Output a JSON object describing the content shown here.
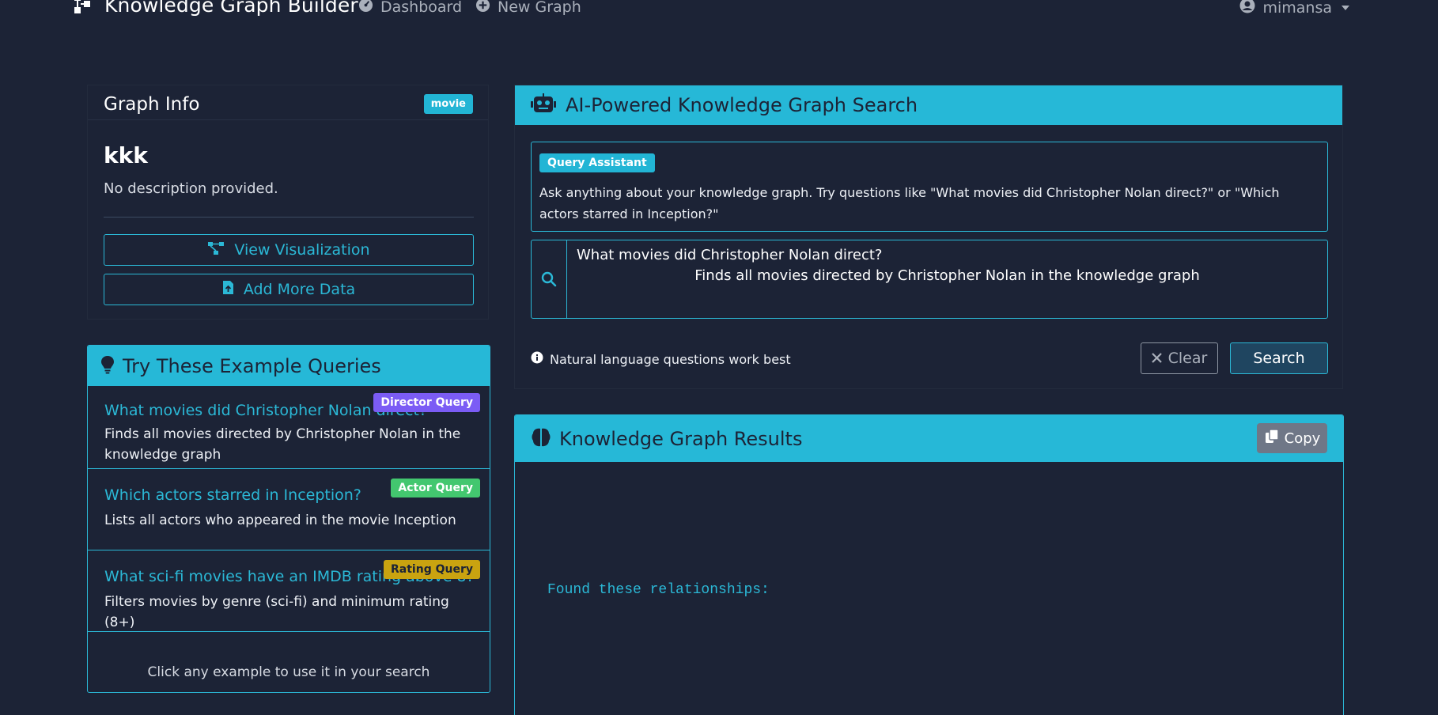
{
  "navbar": {
    "brand": "Knowledge Graph Builder",
    "links": [
      {
        "label": "Dashboard",
        "icon": "dashboard-icon"
      },
      {
        "label": "New Graph",
        "icon": "plus-circle-icon"
      }
    ],
    "user": "mimansa"
  },
  "graph_info": {
    "title": "Graph Info",
    "badge": "movie",
    "name": "kkk",
    "description": "No description provided.",
    "view_button": "View Visualization",
    "add_button": "Add More Data"
  },
  "examples": {
    "title": "Try These Example Queries",
    "items": [
      {
        "query": "What movies did Christopher Nolan direct?",
        "badge": "Director Query",
        "description": "Finds all movies directed by Christopher Nolan in the knowledge graph"
      },
      {
        "query": "Which actors starred in Inception?",
        "badge": "Actor Query",
        "description": "Lists all actors who appeared in the movie Inception"
      },
      {
        "query": "What sci-fi movies have an IMDB rating above 8?",
        "badge": "Rating Query",
        "description": "Filters movies by genre (sci-fi) and minimum rating (8+)"
      }
    ],
    "footer": "Click any example to use it in your search"
  },
  "search": {
    "title": "AI-Powered Knowledge Graph Search",
    "assistant_badge": "Query Assistant",
    "assistant_text": "Ask anything about your knowledge graph. Try questions like \"What movies did Christopher Nolan direct?\" or \"Which actors starred in Inception?\"",
    "query_value": "What movies did Christopher Nolan direct?",
    "query_subtext": "Finds all movies directed by Christopher Nolan in the knowledge graph",
    "hint": "Natural language questions work best",
    "clear_button": "Clear",
    "search_button": "Search"
  },
  "results": {
    "title": "Knowledge Graph Results",
    "copy_button": "Copy",
    "text": "Found these relationships:"
  },
  "colors": {
    "background": "#1c2336",
    "accent": "#26b8d7",
    "director_badge": "#7b5cf5",
    "actor_badge": "#43c76f",
    "rating_badge": "#c9a310"
  }
}
